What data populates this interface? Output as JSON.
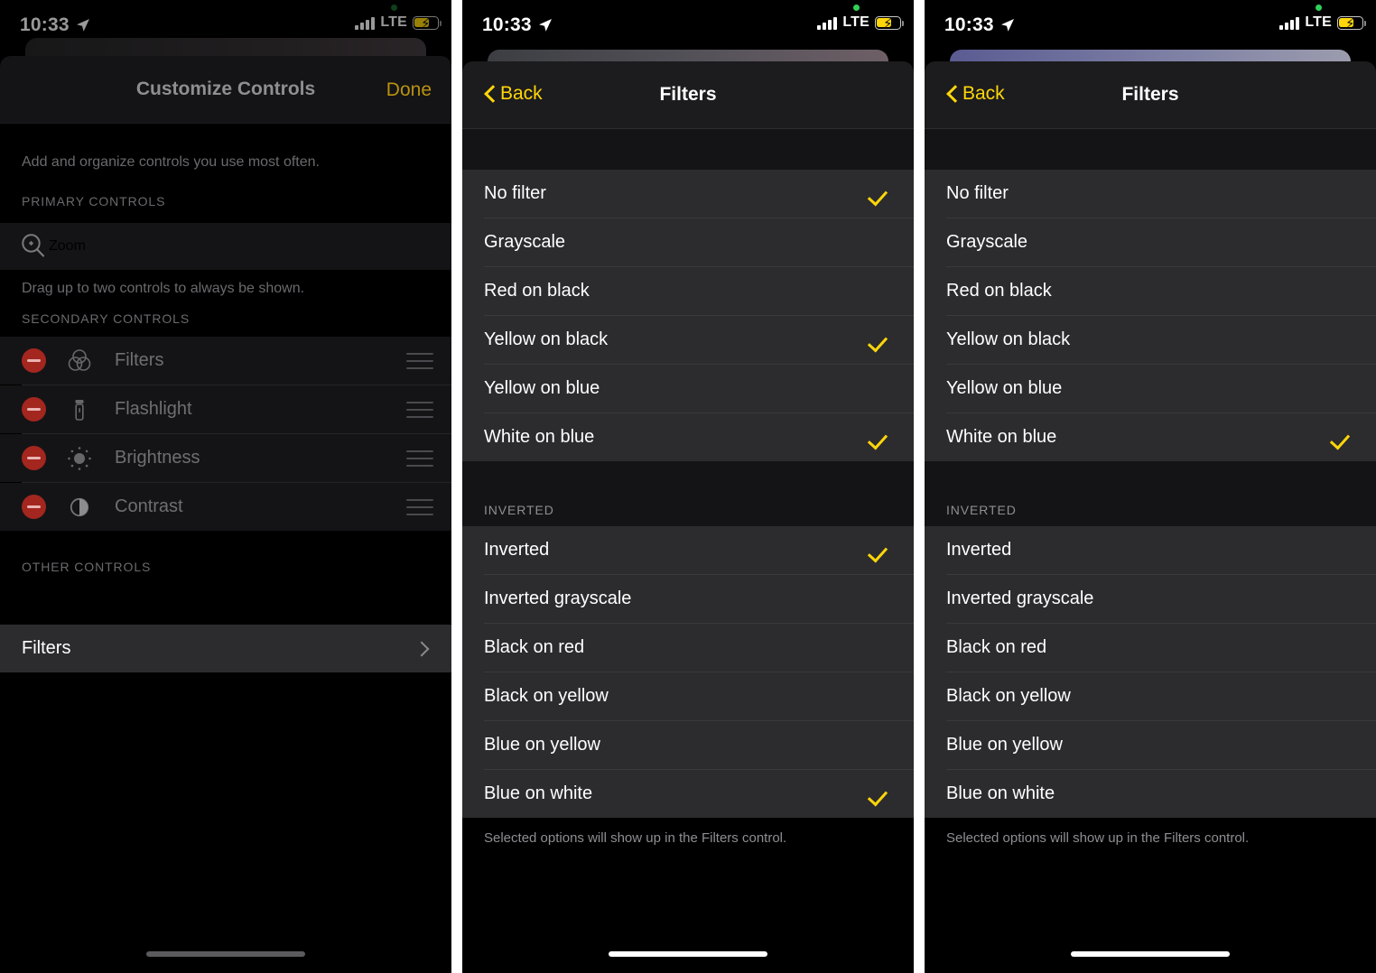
{
  "statusbar": {
    "time": "10:33",
    "carrier": "LTE",
    "location_icon": "location-arrow-icon",
    "signal_icon": "cellular-bars-icon",
    "battery_icon": "battery-charging-icon",
    "recording_dot": "green-status-dot"
  },
  "colors": {
    "accent_yellow": "#ffd60a",
    "done_yellow": "#b8920f",
    "row_bg": "#2c2c2e",
    "sheet_bg": "#000000",
    "separator": "#3a3a3c",
    "secondary_text": "#8e8e93",
    "remove_red": "#a3261f",
    "status_green": "#30d158"
  },
  "panel1": {
    "nav": {
      "title": "Customize Controls",
      "done_label": "Done"
    },
    "blurb": "Add and organize controls you use most often.",
    "primary_header": "PRIMARY CONTROLS",
    "primary_items": [
      {
        "label": "Zoom",
        "icon": "zoom-magnifier-icon"
      }
    ],
    "primary_footnote": "Drag up to two controls to always be shown.",
    "secondary_header": "SECONDARY CONTROLS",
    "secondary_items": [
      {
        "label": "Filters",
        "icon": "filters-venn-icon"
      },
      {
        "label": "Flashlight",
        "icon": "flashlight-icon"
      },
      {
        "label": "Brightness",
        "icon": "brightness-sun-icon"
      },
      {
        "label": "Contrast",
        "icon": "contrast-halfcircle-icon"
      }
    ],
    "other_header": "OTHER CONTROLS",
    "other_items": [
      {
        "label": "Filters",
        "icon": "chevron-right-icon"
      }
    ]
  },
  "panel2": {
    "nav": {
      "back_label": "Back",
      "title": "Filters"
    },
    "group1": {
      "header": "",
      "items": [
        {
          "label": "No filter",
          "checked": true
        },
        {
          "label": "Grayscale",
          "checked": false
        },
        {
          "label": "Red on black",
          "checked": false
        },
        {
          "label": "Yellow on black",
          "checked": true
        },
        {
          "label": "Yellow on blue",
          "checked": false
        },
        {
          "label": "White on blue",
          "checked": true
        }
      ]
    },
    "group2": {
      "header": "INVERTED",
      "items": [
        {
          "label": "Inverted",
          "checked": true
        },
        {
          "label": "Inverted grayscale",
          "checked": false
        },
        {
          "label": "Black on red",
          "checked": false
        },
        {
          "label": "Black on yellow",
          "checked": false
        },
        {
          "label": "Blue on yellow",
          "checked": false
        },
        {
          "label": "Blue on white",
          "checked": true
        }
      ]
    },
    "footnote": "Selected options will show up in the Filters control."
  },
  "panel3": {
    "nav": {
      "back_label": "Back",
      "title": "Filters"
    },
    "group1": {
      "header": "",
      "items": [
        {
          "label": "No filter",
          "checked": false
        },
        {
          "label": "Grayscale",
          "checked": false
        },
        {
          "label": "Red on black",
          "checked": false
        },
        {
          "label": "Yellow on black",
          "checked": false
        },
        {
          "label": "Yellow on blue",
          "checked": false
        },
        {
          "label": "White on blue",
          "checked": true
        }
      ]
    },
    "group2": {
      "header": "INVERTED",
      "items": [
        {
          "label": "Inverted",
          "checked": false
        },
        {
          "label": "Inverted grayscale",
          "checked": false
        },
        {
          "label": "Black on red",
          "checked": false
        },
        {
          "label": "Black on yellow",
          "checked": false
        },
        {
          "label": "Blue on yellow",
          "checked": false
        },
        {
          "label": "Blue on white",
          "checked": false
        }
      ]
    },
    "footnote": "Selected options will show up in the Filters control."
  }
}
